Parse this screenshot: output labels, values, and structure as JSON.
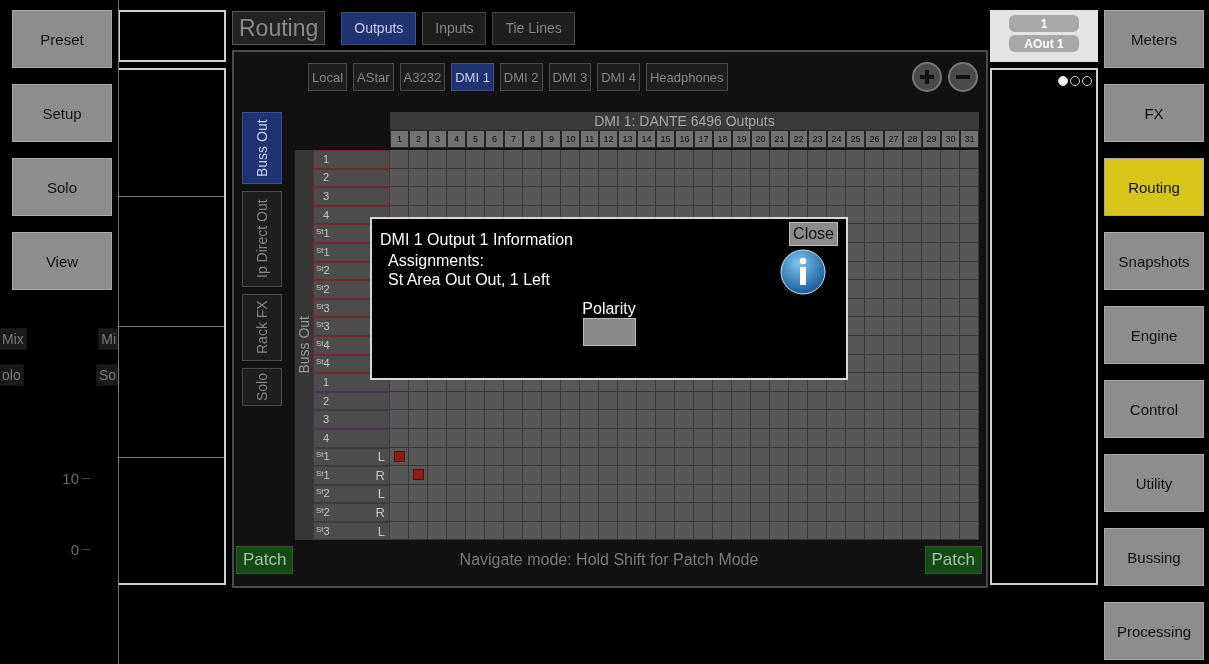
{
  "left_nav": [
    {
      "label": "Preset",
      "selected": false
    },
    {
      "label": "Setup",
      "selected": false
    },
    {
      "label": "Solo",
      "selected": false
    },
    {
      "label": "View",
      "selected": false
    }
  ],
  "background_strip": {
    "chips": [
      {
        "left": "Mix",
        "right": "Mi"
      },
      {
        "left": "olo",
        "right": "So"
      }
    ],
    "scale": [
      "10",
      "0"
    ]
  },
  "routing": {
    "title": "Routing",
    "tabs": [
      {
        "label": "Outputs",
        "selected": true
      },
      {
        "label": "Inputs",
        "selected": false
      },
      {
        "label": "Tie Lines",
        "selected": false
      }
    ],
    "sources": [
      {
        "label": "Local",
        "selected": false
      },
      {
        "label": "AStar",
        "selected": false
      },
      {
        "label": "A3232",
        "selected": false
      },
      {
        "label": "DMI 1",
        "selected": true
      },
      {
        "label": "DMI 2",
        "selected": false
      },
      {
        "label": "DMI 3",
        "selected": false
      },
      {
        "label": "DMI 4",
        "selected": false
      },
      {
        "label": "Headphones",
        "selected": false
      }
    ],
    "categories": [
      {
        "label": "Buss Out",
        "selected": true
      },
      {
        "label": "Ip Direct Out",
        "selected": false
      },
      {
        "label": "Rack FX",
        "selected": false
      },
      {
        "label": "Solo",
        "selected": false
      }
    ],
    "matrix": {
      "title": "DMI 1: DANTE 6496 Outputs",
      "group_label": "Buss Out",
      "columns": [
        "1",
        "2",
        "3",
        "4",
        "5",
        "6",
        "7",
        "8",
        "9",
        "10",
        "11",
        "12",
        "13",
        "14",
        "15",
        "16",
        "17",
        "18",
        "19",
        "20",
        "21",
        "22",
        "23",
        "24",
        "25",
        "26",
        "27",
        "28",
        "29",
        "30",
        "31"
      ],
      "rows": [
        {
          "label": "1",
          "kind": "buss",
          "cells": [
            false,
            false,
            false,
            false,
            false,
            false,
            false,
            false,
            false,
            false,
            false,
            false,
            false,
            false,
            false,
            false,
            false,
            false,
            false,
            false,
            false,
            false,
            false,
            false,
            false,
            false,
            false,
            false,
            false,
            false,
            false
          ]
        },
        {
          "label": "2",
          "kind": "buss",
          "cells": [
            false,
            false,
            false,
            false,
            false,
            false,
            false,
            false,
            false,
            false,
            false,
            false,
            false,
            false,
            false,
            false,
            false,
            false,
            false,
            false,
            false,
            false,
            false,
            false,
            false,
            false,
            false,
            false,
            false,
            false,
            false
          ]
        },
        {
          "label": "3",
          "kind": "buss",
          "cells": [
            false,
            false,
            false,
            false,
            false,
            false,
            false,
            false,
            false,
            false,
            false,
            false,
            false,
            false,
            false,
            false,
            false,
            false,
            false,
            false,
            false,
            false,
            false,
            false,
            false,
            false,
            false,
            false,
            false,
            false,
            false
          ]
        },
        {
          "label": "4",
          "kind": "buss",
          "cells": [
            false,
            false,
            false,
            false,
            false,
            false,
            false,
            false,
            false,
            false,
            false,
            false,
            false,
            false,
            false,
            false,
            false,
            false,
            false,
            false,
            false,
            false,
            false,
            false,
            false,
            false,
            false,
            false,
            false,
            false,
            false
          ]
        },
        {
          "label": "$^{St}$1",
          "kind": "buss"
        },
        {
          "label": "$^{St}$1",
          "kind": "buss"
        },
        {
          "label": "$^{St}$2",
          "kind": "buss"
        },
        {
          "label": "$^{St}$2",
          "kind": "buss"
        },
        {
          "label": "$^{St}$3",
          "kind": "buss"
        },
        {
          "label": "$^{St}$3",
          "kind": "buss"
        },
        {
          "label": "$^{St}$4",
          "kind": "buss"
        },
        {
          "label": "$^{St}$4",
          "kind": "buss"
        },
        {
          "label": "1",
          "kind": "matrix",
          "cells": [
            false,
            false,
            false,
            false,
            false,
            false,
            false,
            false,
            false,
            false,
            false,
            false,
            false,
            false,
            false,
            false,
            false,
            false,
            false,
            false,
            false,
            false,
            false,
            false,
            false,
            false,
            false,
            false,
            false,
            false,
            false
          ]
        },
        {
          "label": "2",
          "kind": "matrix",
          "cells": [
            false,
            false,
            false,
            false,
            false,
            false,
            false,
            false,
            false,
            false,
            false,
            false,
            false,
            false,
            false,
            false,
            false,
            false,
            false,
            false,
            false,
            false,
            false,
            false,
            false,
            false,
            false,
            false,
            false,
            false,
            false
          ]
        },
        {
          "label": "3",
          "kind": "matrix",
          "cells": [
            false,
            false,
            false,
            false,
            false,
            false,
            false,
            false,
            false,
            false,
            false,
            false,
            false,
            false,
            false,
            false,
            false,
            false,
            false,
            false,
            false,
            false,
            false,
            false,
            false,
            false,
            false,
            false,
            false,
            false,
            false
          ]
        },
        {
          "label": "4",
          "kind": "matrix",
          "cells": [
            false,
            false,
            false,
            false,
            false,
            false,
            false,
            false,
            false,
            false,
            false,
            false,
            false,
            false,
            false,
            false,
            false,
            false,
            false,
            false,
            false,
            false,
            false,
            false,
            false,
            false,
            false,
            false,
            false,
            false,
            false
          ]
        },
        {
          "label": "$^{St}$1",
          "side": "L",
          "kind": "main",
          "cells": [
            true,
            false,
            false,
            false,
            false,
            false,
            false,
            false,
            false,
            false,
            false,
            false,
            false,
            false,
            false,
            false,
            false,
            false,
            false,
            false,
            false,
            false,
            false,
            false,
            false,
            false,
            false,
            false,
            false,
            false,
            false
          ]
        },
        {
          "label": "$^{St}$1",
          "side": "R",
          "kind": "main",
          "cells": [
            false,
            true,
            false,
            false,
            false,
            false,
            false,
            false,
            false,
            false,
            false,
            false,
            false,
            false,
            false,
            false,
            false,
            false,
            false,
            false,
            false,
            false,
            false,
            false,
            false,
            false,
            false,
            false,
            false,
            false,
            false
          ]
        },
        {
          "label": "$^{St}$2",
          "side": "L",
          "kind": "main",
          "cells": [
            false,
            false,
            false,
            false,
            false,
            false,
            false,
            false,
            false,
            false,
            false,
            false,
            false,
            false,
            false,
            false,
            false,
            false,
            false,
            false,
            false,
            false,
            false,
            false,
            false,
            false,
            false,
            false,
            false,
            false,
            false
          ]
        },
        {
          "label": "$^{St}$2",
          "side": "R",
          "kind": "main",
          "cells": [
            false,
            false,
            false,
            false,
            false,
            false,
            false,
            false,
            false,
            false,
            false,
            false,
            false,
            false,
            false,
            false,
            false,
            false,
            false,
            false,
            false,
            false,
            false,
            false,
            false,
            false,
            false,
            false,
            false,
            false,
            false
          ]
        },
        {
          "label": "$^{St}$3",
          "side": "L",
          "kind": "main",
          "cells": [
            false,
            false,
            false,
            false,
            false,
            false,
            false,
            false,
            false,
            false,
            false,
            false,
            false,
            false,
            false,
            false,
            false,
            false,
            false,
            false,
            false,
            false,
            false,
            false,
            false,
            false,
            false,
            false,
            false,
            false,
            false
          ]
        }
      ]
    },
    "footer": {
      "patch_left": "Patch",
      "hint": "Navigate mode: Hold Shift for Patch Mode",
      "patch_right": "Patch"
    },
    "dialog": {
      "title": "DMI 1 Output 1 Information",
      "close": "Close",
      "assignments_label": "Assignments:",
      "assignment": "St Area Out Out, 1 Left",
      "polarity_label": "Polarity",
      "polarity_on": false
    }
  },
  "channel_header": {
    "number": "1",
    "name": "AOut 1"
  },
  "page_dots": [
    {
      "selected": true
    },
    {
      "selected": false
    },
    {
      "selected": false
    }
  ],
  "right_nav": [
    {
      "label": "Meters",
      "selected": false
    },
    {
      "label": "FX",
      "selected": false
    },
    {
      "label": "Routing",
      "selected": true
    },
    {
      "label": "Snapshots",
      "selected": false
    },
    {
      "label": "Engine",
      "selected": false
    },
    {
      "label": "Control",
      "selected": false
    },
    {
      "label": "Utility",
      "selected": false
    },
    {
      "label": "Bussing",
      "selected": false
    },
    {
      "label": "Processing",
      "selected": false
    }
  ]
}
